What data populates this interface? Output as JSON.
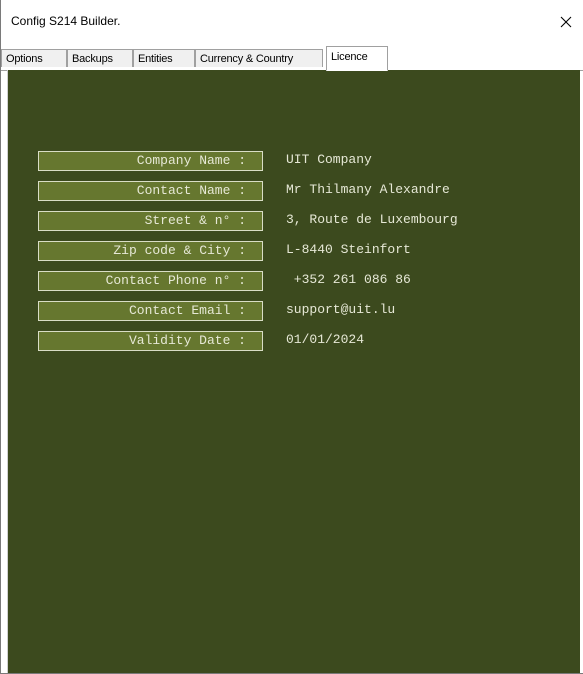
{
  "window": {
    "title": "Config S214 Builder.",
    "close_glyph": "close-icon"
  },
  "tabs": [
    {
      "label": "Options",
      "active": false
    },
    {
      "label": "Backups",
      "active": false
    },
    {
      "label": "Entities",
      "active": false
    },
    {
      "label": "Currency & Country",
      "active": false
    },
    {
      "label": "Licence",
      "active": true
    }
  ],
  "colors": {
    "panel_background": "#3c4a1e",
    "label_box_background": "#66772f",
    "text": "#e6e8d6"
  },
  "licence": {
    "fields": [
      {
        "label": "Company Name :",
        "value": "UIT Company"
      },
      {
        "label": "Contact Name :",
        "value": "Mr Thilmany Alexandre"
      },
      {
        "label": "Street & n° :",
        "value": "3, Route de Luxembourg"
      },
      {
        "label": "Zip code & City :",
        "value": "L-8440 Steinfort"
      },
      {
        "label": "Contact Phone n° :",
        "value": " +352 261 086 86"
      },
      {
        "label": "Contact Email :",
        "value": "support@uit.lu"
      },
      {
        "label": "Validity Date :",
        "value": "01/01/2024"
      }
    ]
  }
}
